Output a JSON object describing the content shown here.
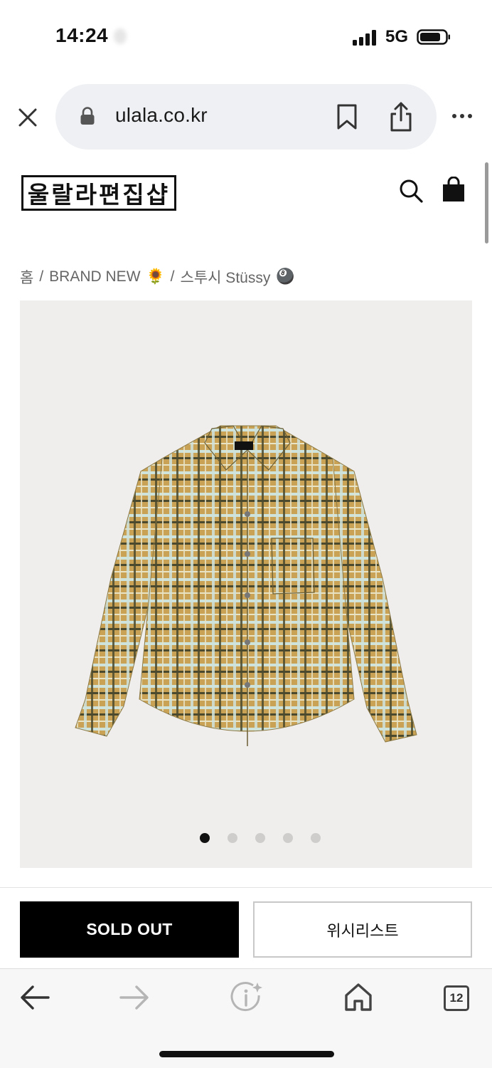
{
  "status_bar": {
    "time": "14:24",
    "network": "5G",
    "battery_percent": 80
  },
  "browser": {
    "url": "ulala.co.kr",
    "tab_count": "12",
    "icons": {
      "close": "close-icon",
      "lock": "lock-icon",
      "bookmark": "bookmark-icon",
      "share": "share-icon",
      "more": "more-icon",
      "back": "back-arrow-icon",
      "forward": "forward-arrow-icon",
      "info": "info-sparkle-icon",
      "home": "home-icon",
      "tabs": "tabs-icon"
    }
  },
  "site": {
    "logo_text": "울랄라편집샵",
    "icons": {
      "search": "search-icon",
      "cart": "shopping-bag-icon"
    }
  },
  "breadcrumb": {
    "items": [
      {
        "label": "홈"
      },
      {
        "label": "BRAND NEW",
        "emoji": "🌻"
      },
      {
        "label": "스투시 Stüssy",
        "emoji": "🎱"
      }
    ],
    "separator": "/"
  },
  "product": {
    "image": "plaid-shirt-image",
    "carousel": {
      "total": 5,
      "active_index": 0
    },
    "colors": {
      "frame_bg": "#f0eeec",
      "plaid_base": "#c9a255",
      "plaid_dark": "#4b4a2e",
      "plaid_light": "#cfe3dd"
    }
  },
  "actions": {
    "sold_out_label": "SOLD OUT",
    "wishlist_label": "위시리스트"
  }
}
